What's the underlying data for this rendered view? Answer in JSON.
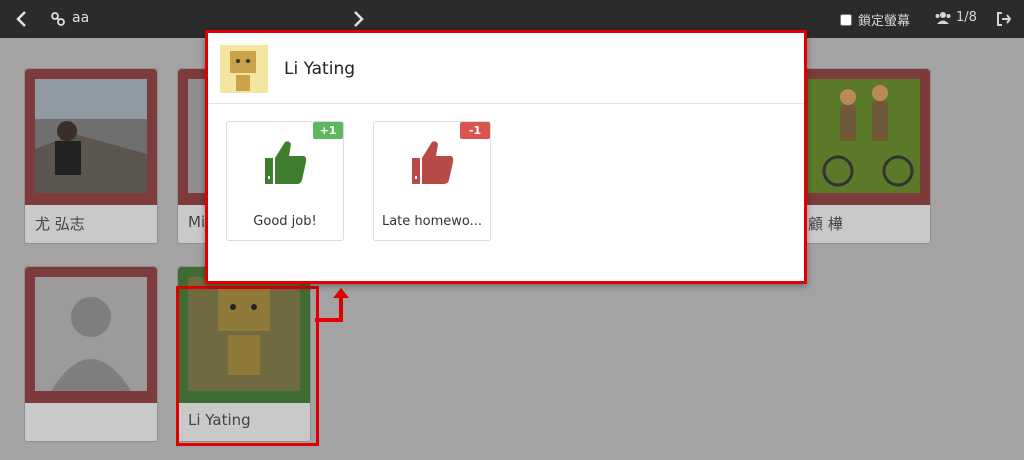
{
  "topbar": {
    "class_name": "aa",
    "lock_screen_label": "鎖定螢幕",
    "page_indicator": "1/8"
  },
  "students": [
    {
      "name": "尤 弘志",
      "status": "red"
    },
    {
      "name": "Mi",
      "status": "red"
    },
    {
      "name": "顧 樺",
      "status": "red"
    },
    {
      "name": "",
      "status": "red"
    },
    {
      "name": "Li Yating",
      "status": "green"
    }
  ],
  "popup": {
    "student_name": "Li Yating",
    "behaviors": [
      {
        "label": "Good job!",
        "points": "+1",
        "color": "#5cb85c",
        "icon": "thumbs-up-icon"
      },
      {
        "label": "Late homewo...",
        "points": "-1",
        "color": "#d9534f",
        "icon": "thumbs-down-icon"
      }
    ]
  },
  "colors": {
    "positive": "#5cb85c",
    "negative": "#d9534f",
    "highlight": "#e00000"
  }
}
